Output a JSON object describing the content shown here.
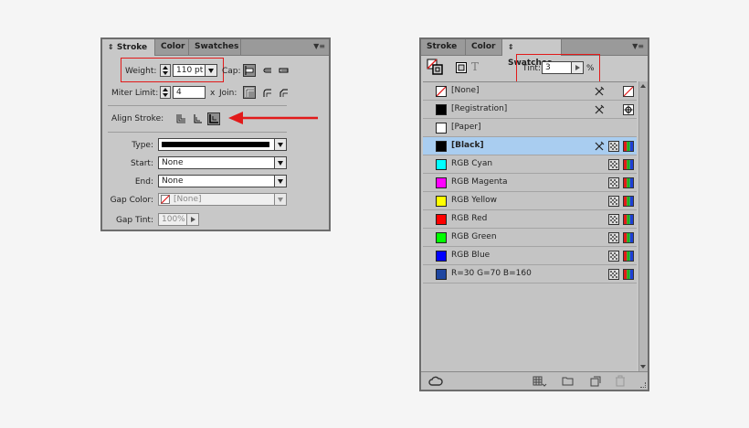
{
  "stroke_panel": {
    "tabs": [
      "Stroke",
      "Color",
      "Swatches"
    ],
    "weight_label": "Weight:",
    "weight_value": "110 pt",
    "cap_label": "Cap:",
    "miter_label": "Miter Limit:",
    "miter_value": "4",
    "x_label": "x",
    "join_label": "Join:",
    "align_label": "Align Stroke:",
    "type_label": "Type:",
    "start_label": "Start:",
    "start_value": "None",
    "end_label": "End:",
    "end_value": "None",
    "gap_color_label": "Gap Color:",
    "gap_color_value": "[None]",
    "gap_tint_label": "Gap Tint:",
    "gap_tint_value": "100%"
  },
  "swatches_panel": {
    "tabs": [
      "Stroke",
      "Color",
      "Swatches"
    ],
    "tint_label": "Tint:",
    "tint_value": "3",
    "tint_unit": "%",
    "text_icon_glyph": "T",
    "items": [
      {
        "name": "[None]",
        "color": "#ffffff",
        "kind": "none"
      },
      {
        "name": "[Registration]",
        "color": "#000000",
        "kind": "registration"
      },
      {
        "name": "[Paper]",
        "color": "#ffffff",
        "kind": "paper"
      },
      {
        "name": "[Black]",
        "color": "#000000",
        "kind": "black",
        "selected": true
      },
      {
        "name": "RGB Cyan",
        "color": "#00ffff",
        "kind": "rgb"
      },
      {
        "name": "RGB Magenta",
        "color": "#ff00ff",
        "kind": "rgb"
      },
      {
        "name": "RGB Yellow",
        "color": "#ffff00",
        "kind": "rgb"
      },
      {
        "name": "RGB Red",
        "color": "#ff0000",
        "kind": "rgb"
      },
      {
        "name": "RGB Green",
        "color": "#00ff00",
        "kind": "rgb"
      },
      {
        "name": "RGB Blue",
        "color": "#0000ff",
        "kind": "rgb"
      },
      {
        "name": "R=30 G=70 B=160",
        "color": "#1e46a0",
        "kind": "rgb"
      }
    ]
  },
  "colors": {
    "highlight_red": "#e21a1a",
    "selected_row": "#a9cdf0",
    "panel_bg": "#c8c8c8"
  }
}
